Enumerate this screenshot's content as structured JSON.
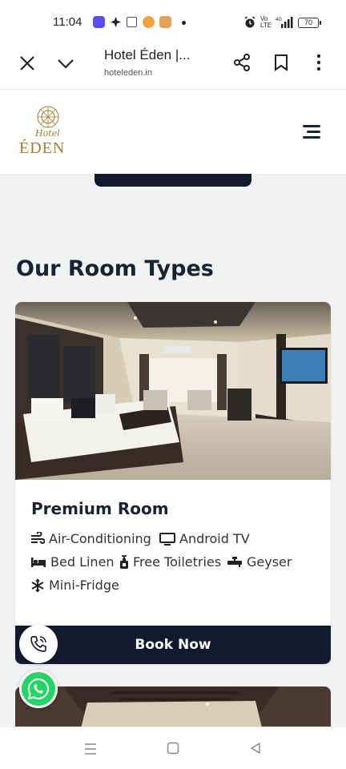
{
  "status_bar": {
    "time": "11:04",
    "battery": "70"
  },
  "browser": {
    "title": "Hotel Éden |...",
    "url": "hoteleden.in"
  },
  "site": {
    "logo_top": "Hotel",
    "logo_main": "ÉDEN"
  },
  "section": {
    "title": "Our Room Types"
  },
  "room": {
    "name": "Premium Room",
    "amenities": [
      {
        "label": "Air-Conditioning",
        "icon": "wind-icon"
      },
      {
        "label": "Android TV",
        "icon": "tv-icon"
      },
      {
        "label": "Bed Linen",
        "icon": "bed-icon"
      },
      {
        "label": "Free Toiletries",
        "icon": "pump-bottle-icon"
      },
      {
        "label": "Geyser",
        "icon": "faucet-icon"
      },
      {
        "label": "Mini-Fridge",
        "icon": "snowflake-icon"
      }
    ],
    "book_label": "Book Now"
  },
  "colors": {
    "primary_dark": "#141a2e",
    "logo_gold": "#a77b2e",
    "whatsapp": "#25d366",
    "page_bg": "#f1f2f4"
  }
}
